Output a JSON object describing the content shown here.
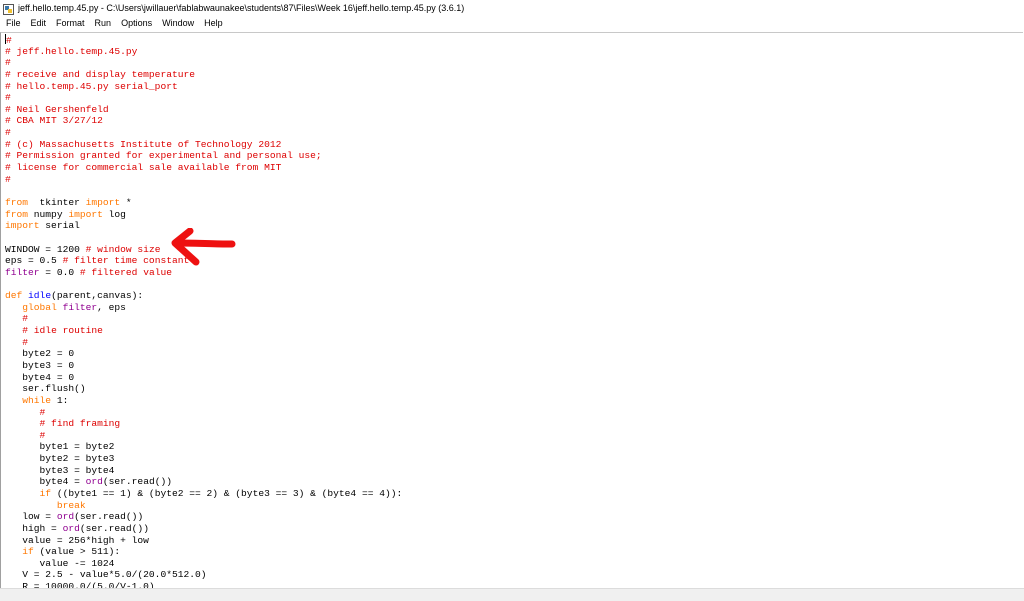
{
  "window": {
    "title": "jeff.hello.temp.45.py - C:\\Users\\jwillauer\\fablabwaunakee\\students\\87\\Files\\Week 16\\jeff.hello.temp.45.py (3.6.1)"
  },
  "menu": {
    "items": [
      "File",
      "Edit",
      "Format",
      "Run",
      "Options",
      "Window",
      "Help"
    ]
  },
  "colors": {
    "keyword": "#ff7700",
    "comment": "#dd0000",
    "builtin": "#900090",
    "definition": "#0000ff",
    "annotation_arrow": "#ee1111"
  },
  "code": {
    "lines": [
      [
        [
          "cm",
          "#"
        ]
      ],
      [
        [
          "cm",
          "# jeff.hello.temp.45.py"
        ]
      ],
      [
        [
          "cm",
          "#"
        ]
      ],
      [
        [
          "cm",
          "# receive and display temperature"
        ]
      ],
      [
        [
          "cm",
          "# hello.temp.45.py serial_port"
        ]
      ],
      [
        [
          "cm",
          "#"
        ]
      ],
      [
        [
          "cm",
          "# Neil Gershenfeld"
        ]
      ],
      [
        [
          "cm",
          "# CBA MIT 3/27/12"
        ]
      ],
      [
        [
          "cm",
          "#"
        ]
      ],
      [
        [
          "cm",
          "# (c) Massachusetts Institute of Technology 2012"
        ]
      ],
      [
        [
          "cm",
          "# Permission granted for experimental and personal use;"
        ]
      ],
      [
        [
          "cm",
          "# license for commercial sale available from MIT"
        ]
      ],
      [
        [
          "cm",
          "#"
        ]
      ],
      [],
      [
        [
          "kw",
          "from"
        ],
        [
          "",
          "  tkinter "
        ],
        [
          "kw",
          "import"
        ],
        [
          "",
          " *"
        ]
      ],
      [
        [
          "kw",
          "from"
        ],
        [
          "",
          " numpy "
        ],
        [
          "kw",
          "import"
        ],
        [
          "",
          " log"
        ]
      ],
      [
        [
          "kw",
          "import"
        ],
        [
          "",
          " serial"
        ]
      ],
      [],
      [
        [
          "",
          "WINDOW = 1200 "
        ],
        [
          "cm",
          "# window size"
        ]
      ],
      [
        [
          "",
          "eps = 0.5 "
        ],
        [
          "cm",
          "# filter time constant"
        ]
      ],
      [
        [
          "bi",
          "filter"
        ],
        [
          "",
          " = 0.0 "
        ],
        [
          "cm",
          "# filtered value"
        ]
      ],
      [],
      [
        [
          "kw",
          "def"
        ],
        [
          "",
          " "
        ],
        [
          "df",
          "idle"
        ],
        [
          "",
          "(parent,canvas):"
        ]
      ],
      [
        [
          "",
          "   "
        ],
        [
          "kw",
          "global"
        ],
        [
          "",
          " "
        ],
        [
          "bi",
          "filter"
        ],
        [
          "",
          ", eps"
        ]
      ],
      [
        [
          "",
          "   "
        ],
        [
          "cm",
          "#"
        ]
      ],
      [
        [
          "",
          "   "
        ],
        [
          "cm",
          "# idle routine"
        ]
      ],
      [
        [
          "",
          "   "
        ],
        [
          "cm",
          "#"
        ]
      ],
      [
        [
          "",
          "   byte2 = 0"
        ]
      ],
      [
        [
          "",
          "   byte3 = 0"
        ]
      ],
      [
        [
          "",
          "   byte4 = 0"
        ]
      ],
      [
        [
          "",
          "   ser.flush()"
        ]
      ],
      [
        [
          "",
          "   "
        ],
        [
          "kw",
          "while"
        ],
        [
          "",
          " 1:"
        ]
      ],
      [
        [
          "",
          "      "
        ],
        [
          "cm",
          "#"
        ]
      ],
      [
        [
          "",
          "      "
        ],
        [
          "cm",
          "# find framing"
        ]
      ],
      [
        [
          "",
          "      "
        ],
        [
          "cm",
          "#"
        ]
      ],
      [
        [
          "",
          "      byte1 = byte2"
        ]
      ],
      [
        [
          "",
          "      byte2 = byte3"
        ]
      ],
      [
        [
          "",
          "      byte3 = byte4"
        ]
      ],
      [
        [
          "",
          "      byte4 = "
        ],
        [
          "bi",
          "ord"
        ],
        [
          "",
          "(ser.read())"
        ]
      ],
      [
        [
          "",
          "      "
        ],
        [
          "kw",
          "if"
        ],
        [
          "",
          " ((byte1 == 1) & (byte2 == 2) & (byte3 == 3) & (byte4 == 4)):"
        ]
      ],
      [
        [
          "",
          "         "
        ],
        [
          "kw",
          "break"
        ]
      ],
      [
        [
          "",
          "   low = "
        ],
        [
          "bi",
          "ord"
        ],
        [
          "",
          "(ser.read())"
        ]
      ],
      [
        [
          "",
          "   high = "
        ],
        [
          "bi",
          "ord"
        ],
        [
          "",
          "(ser.read())"
        ]
      ],
      [
        [
          "",
          "   value = 256*high + low"
        ]
      ],
      [
        [
          "",
          "   "
        ],
        [
          "kw",
          "if"
        ],
        [
          "",
          " (value > 511):"
        ]
      ],
      [
        [
          "",
          "      value -= 1024"
        ]
      ],
      [
        [
          "",
          "   V = 2.5 - value*5.0/(20.0*512.0)"
        ]
      ],
      [
        [
          "",
          "   R = 10000.0/(5.0/V-1.0)"
        ]
      ]
    ]
  }
}
